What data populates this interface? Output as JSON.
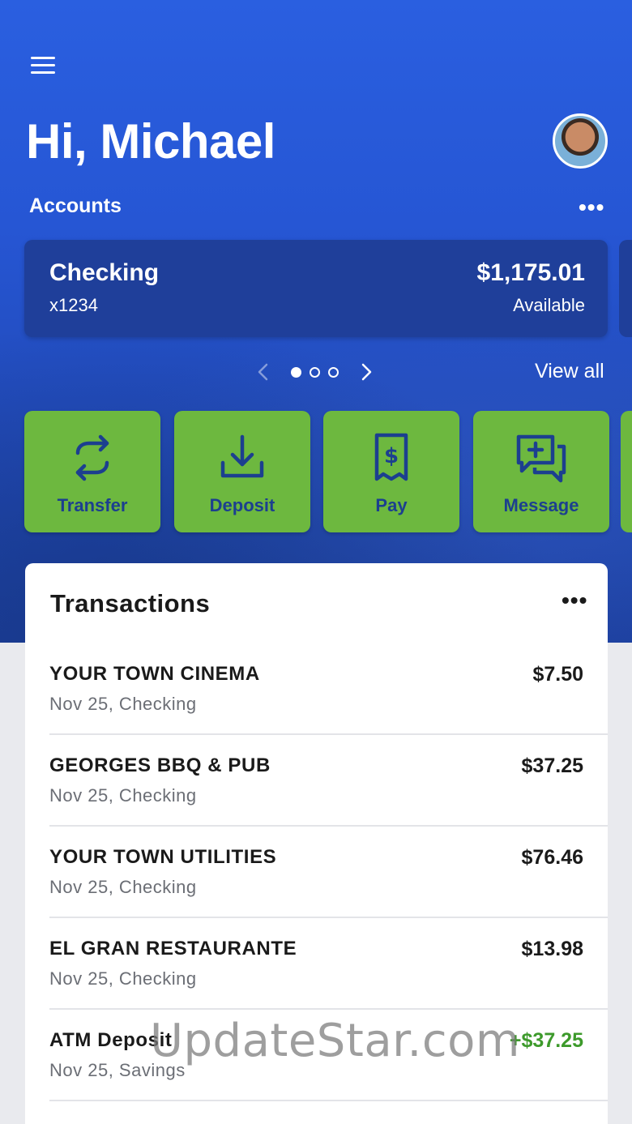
{
  "greeting": "Hi, Michael",
  "accounts": {
    "label": "Accounts",
    "more": "•••",
    "card": {
      "name": "Checking",
      "number": "x1234",
      "balance": "$1,175.01",
      "balance_label": "Available"
    },
    "pager": {
      "total": 3,
      "active": 1
    },
    "view_all": "View all"
  },
  "actions": [
    {
      "label": "Transfer",
      "icon": "transfer-icon"
    },
    {
      "label": "Deposit",
      "icon": "deposit-icon"
    },
    {
      "label": "Pay",
      "icon": "pay-receipt-icon"
    },
    {
      "label": "Message",
      "icon": "message-icon"
    }
  ],
  "transactions": {
    "title": "Transactions",
    "more": "•••",
    "items": [
      {
        "name": "YOUR TOWN CINEMA",
        "sub": "Nov 25, Checking",
        "amount": "$7.50"
      },
      {
        "name": "GEORGES BBQ & PUB",
        "sub": "Nov 25, Checking",
        "amount": "$37.25"
      },
      {
        "name": "YOUR TOWN UTILITIES",
        "sub": "Nov 25, Checking",
        "amount": "$76.46"
      },
      {
        "name": "EL GRAN RESTAURANTE",
        "sub": "Nov 25, Checking",
        "amount": "$13.98"
      },
      {
        "name": "ATM Deposit",
        "sub": "Nov 25, Savings",
        "amount": "+$37.25"
      }
    ]
  },
  "watermark": "UpdateStar.com",
  "colors": {
    "hero_blue": "#2656d4",
    "card_navy": "#1f3f9a",
    "action_green": "#6db83f",
    "action_text": "#1c3f8f",
    "credit_green": "#3d9a2b"
  }
}
